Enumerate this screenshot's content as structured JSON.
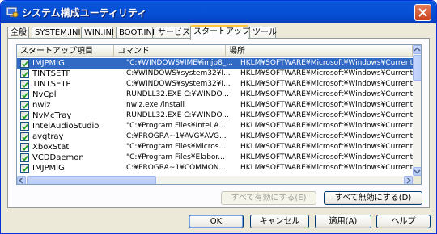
{
  "window": {
    "title": "システム構成ユーティリティ",
    "close_label": "Close"
  },
  "tabs": [
    {
      "label": "全般",
      "active": false
    },
    {
      "label": "SYSTEM.INI",
      "active": false
    },
    {
      "label": "WIN.INI",
      "active": false
    },
    {
      "label": "BOOT.INI",
      "active": false
    },
    {
      "label": "サービス",
      "active": false
    },
    {
      "label": "スタートアップ",
      "active": true
    },
    {
      "label": "ツール",
      "active": false
    }
  ],
  "table": {
    "columns": [
      "スタートアップ項目",
      "コマンド",
      "場所"
    ],
    "rows": [
      {
        "checked": true,
        "selected": true,
        "item": "IMJPMIG",
        "command": "\"C:¥WINDOWS¥IME¥imjp8_...",
        "location": "HKLM¥SOFTWARE¥Microsoft¥Windows¥CurrentVersion¥Run"
      },
      {
        "checked": true,
        "selected": false,
        "item": "TINTSETP",
        "command": "C:¥WINDOWS¥system32¥I...",
        "location": "HKLM¥SOFTWARE¥Microsoft¥Windows¥CurrentVersion¥Run"
      },
      {
        "checked": true,
        "selected": false,
        "item": "TINTSETP",
        "command": "C:¥WINDOWS¥system32¥I...",
        "location": "HKLM¥SOFTWARE¥Microsoft¥Windows¥CurrentVersion¥Run"
      },
      {
        "checked": true,
        "selected": false,
        "item": "NvCpl",
        "command": "RUNDLL32.EXE C:¥WINDO...",
        "location": "HKLM¥SOFTWARE¥Microsoft¥Windows¥CurrentVersion¥Run"
      },
      {
        "checked": true,
        "selected": false,
        "item": "nwiz",
        "command": "nwiz.exe /install",
        "location": "HKLM¥SOFTWARE¥Microsoft¥Windows¥CurrentVersion¥Run"
      },
      {
        "checked": true,
        "selected": false,
        "item": "NvMcTray",
        "command": "RUNDLL32.EXE C:¥WINDO...",
        "location": "HKLM¥SOFTWARE¥Microsoft¥Windows¥CurrentVersion¥Run"
      },
      {
        "checked": true,
        "selected": false,
        "item": "IntelAudioStudio",
        "command": "\"C:¥Program Files¥Intel A...",
        "location": "HKLM¥SOFTWARE¥Microsoft¥Windows¥CurrentVersion¥Run"
      },
      {
        "checked": true,
        "selected": false,
        "item": "avgtray",
        "command": "C:¥PROGRA~1¥AVG¥AVG...",
        "location": "HKLM¥SOFTWARE¥Microsoft¥Windows¥CurrentVersion¥Run"
      },
      {
        "checked": true,
        "selected": false,
        "item": "XboxStat",
        "command": "\"C:¥Program Files¥Micros...",
        "location": "HKLM¥SOFTWARE¥Microsoft¥Windows¥CurrentVersion¥Run"
      },
      {
        "checked": true,
        "selected": false,
        "item": "VCDDaemon",
        "command": "\"C:¥Program Files¥Elabor...",
        "location": "HKLM¥SOFTWARE¥Microsoft¥Windows¥CurrentVersion¥Run"
      },
      {
        "checked": true,
        "selected": false,
        "item": "IMJPMIG",
        "command": "C:¥PROGRA~1¥COMMON...",
        "location": "HKLM¥SOFTWARE¥Microsoft¥Windows¥CurrentVersion¥Run"
      }
    ]
  },
  "buttons": {
    "enable_all": "すべて有効にする(E)",
    "disable_all": "すべて無効にする(D)",
    "ok": "OK",
    "cancel": "キャンセル",
    "apply": "適用(A)",
    "help": "ヘルプ"
  }
}
